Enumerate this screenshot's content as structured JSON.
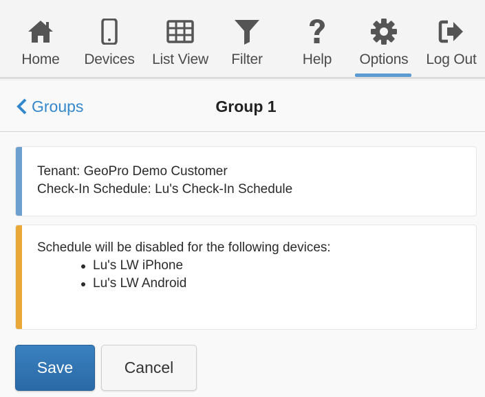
{
  "colors": {
    "nav_icon": "#555555",
    "accent_blue": "#3388cc",
    "info_bar": "#6da0cf",
    "warning_bar": "#eaa836",
    "save_button": "#2f73b3"
  },
  "nav": {
    "items": [
      {
        "label": "Home",
        "icon": "home-icon"
      },
      {
        "label": "Devices",
        "icon": "mobile-device-icon"
      },
      {
        "label": "List View",
        "icon": "grid-list-icon"
      },
      {
        "label": "Filter",
        "icon": "filter-funnel-icon"
      },
      {
        "label": "Help",
        "icon": "question-mark-icon"
      },
      {
        "label": "Options",
        "icon": "gear-icon",
        "active": true
      },
      {
        "label": "Log Out",
        "icon": "log-out-icon"
      }
    ]
  },
  "header": {
    "back_label": "Groups",
    "title": "Group 1"
  },
  "info_card": {
    "tenant_line": "Tenant: GeoPro Demo Customer",
    "schedule_line": "Check-In Schedule: Lu's Check-In Schedule"
  },
  "warning_card": {
    "message": "Schedule will be disabled for the following devices:",
    "devices": [
      "Lu's LW iPhone",
      "Lu's LW Android"
    ]
  },
  "buttons": {
    "save_label": "Save",
    "cancel_label": "Cancel"
  }
}
